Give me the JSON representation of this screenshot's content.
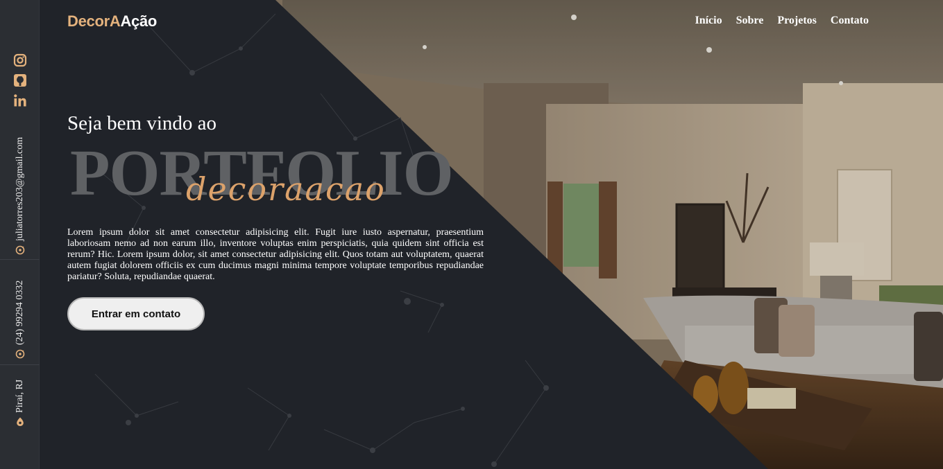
{
  "brand": {
    "part1": "DecorA",
    "part2": "Ação",
    "accent": "#e4b27d"
  },
  "nav": [
    {
      "label": "Início"
    },
    {
      "label": "Sobre"
    },
    {
      "label": "Projetos"
    },
    {
      "label": "Contato"
    }
  ],
  "sidebar": {
    "social_icons": [
      "instagram-icon",
      "github-icon",
      "linkedin-icon"
    ],
    "email": "juliatorres203@gmail.com",
    "phone": "(24) 99294 0332",
    "location": "Piraí, RJ"
  },
  "hero": {
    "welcome": "Seja bem vindo ao",
    "title": "PORTFOLIO",
    "script": "decoraacao",
    "body": "Lorem ipsum dolor sit amet consectetur adipisicing elit. Fugit iure iusto aspernatur, praesentium laboriosam nemo ad non earum illo, inventore voluptas enim perspiciatis, quia quidem sint officia est rerum? Hic. Lorem ipsum dolor, sit amet consectetur adipisicing elit. Quos totam aut voluptatem, quaerat autem fugiat dolorem officiis ex cum ducimus magni minima tempore voluptate temporibus repudiandae pariatur? Soluta, repudiandae quaerat.",
    "cta": "Entrar em contato"
  },
  "colors": {
    "dark_bg": "#202329",
    "sidebar_bg": "#2b2e33",
    "script_gold": "#dca26b"
  }
}
